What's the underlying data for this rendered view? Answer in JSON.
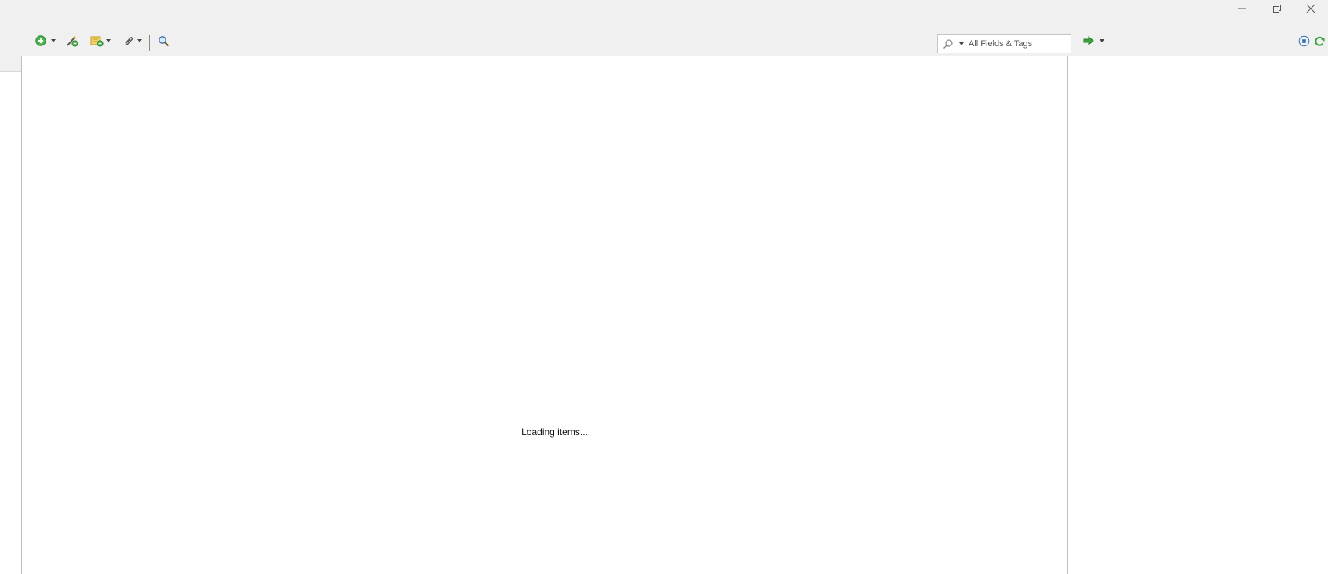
{
  "window": {
    "controls": {
      "minimize": "minimize-icon",
      "restore": "restore-icon",
      "close": "close-icon"
    }
  },
  "toolbar": {
    "buttons": [
      {
        "name": "new-item",
        "icon": "plus-circle-icon",
        "dropdown": true
      },
      {
        "name": "add-by-identifier",
        "icon": "magic-wand-icon",
        "dropdown": false
      },
      {
        "name": "new-note",
        "icon": "note-icon",
        "dropdown": true
      },
      {
        "name": "add-attachment",
        "icon": "paperclip-icon",
        "dropdown": true
      },
      {
        "name": "advanced-search",
        "icon": "magnifier-icon",
        "dropdown": false
      }
    ],
    "search": {
      "placeholder": "All Fields & Tags",
      "value": ""
    },
    "locate": {
      "icon": "green-arrow-icon",
      "dropdown": true
    },
    "sync": {
      "icons": [
        "stop-sync-icon",
        "sync-icon"
      ]
    }
  },
  "items": {
    "status": "Loading items..."
  },
  "colors": {
    "chrome": "#f0f0f0",
    "accent_green": "#3aa33a",
    "divider": "#bdbdbd"
  }
}
